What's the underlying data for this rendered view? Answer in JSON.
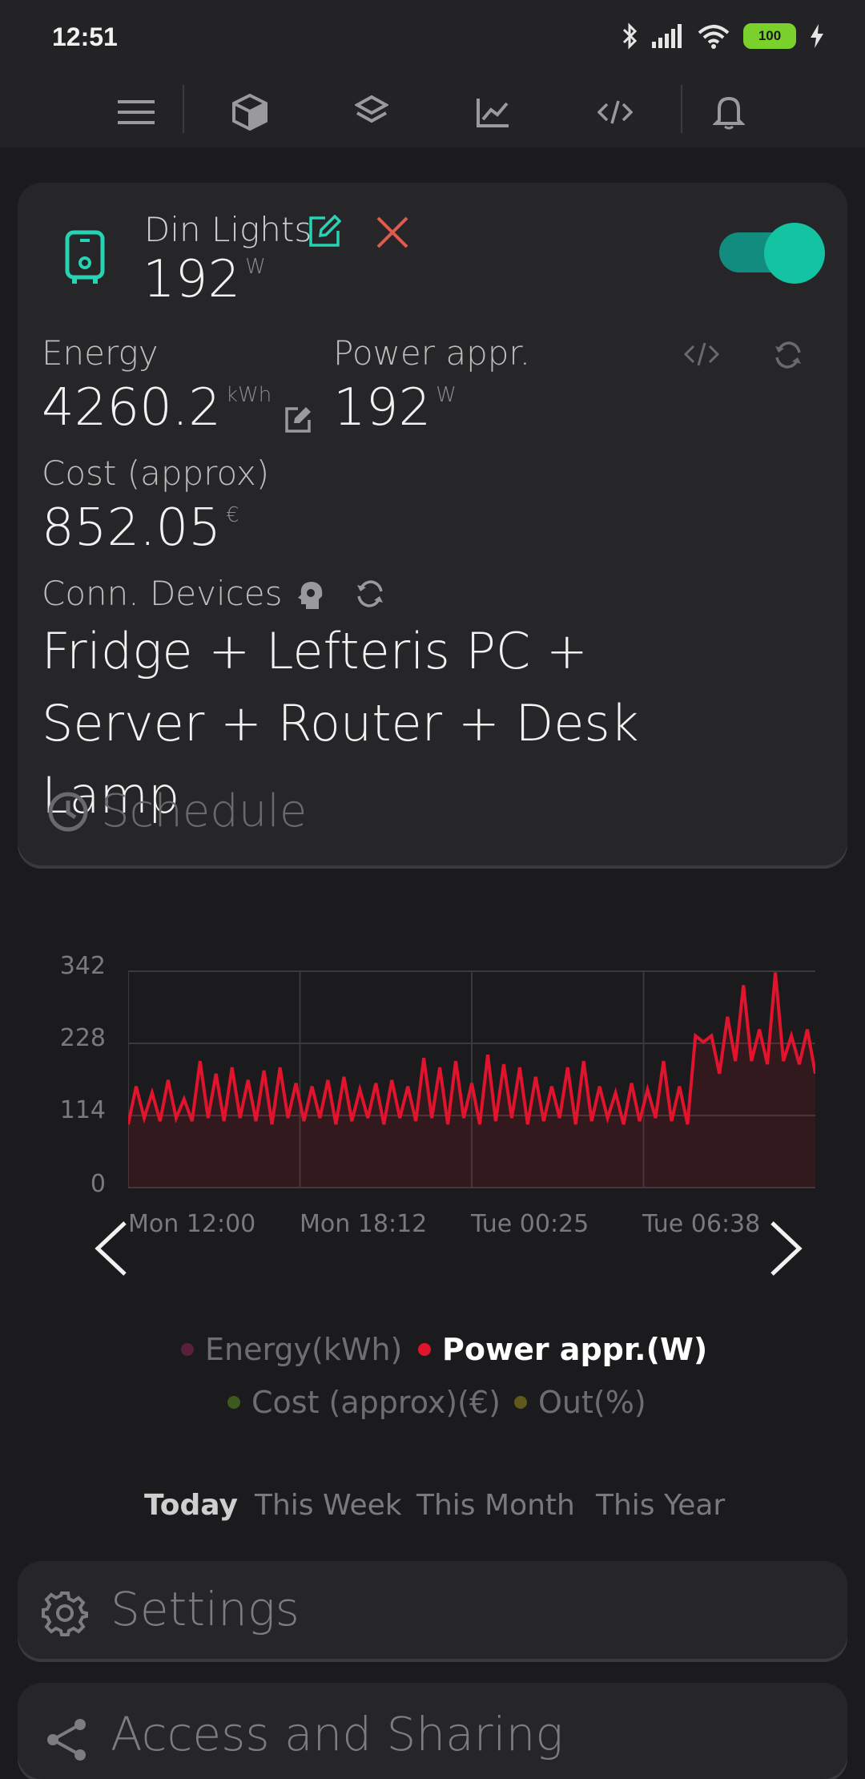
{
  "status_bar": {
    "time": "12:51",
    "battery": "100"
  },
  "nav": {
    "items": [
      "menu-icon",
      "cube-icon",
      "layers-icon",
      "chart-icon",
      "code-icon",
      "bell-icon"
    ]
  },
  "device": {
    "name": "Din Lights",
    "power_value": "192",
    "power_unit": "W",
    "toggle_on": true
  },
  "stats": {
    "energy_label": "Energy",
    "energy_value": "4260.2",
    "energy_unit": "kWh",
    "power_label": "Power appr.",
    "power_value": "192",
    "power_unit": "W",
    "cost_label": "Cost (approx)",
    "cost_value": "852.05",
    "cost_unit": "€",
    "devices_label": "Conn. Devices",
    "devices_value": "Fridge + Lefteris PC + Server + Router + Desk Lamp"
  },
  "schedule_label": "Schedule",
  "chart_data": {
    "type": "area",
    "title": "",
    "ylabel": "",
    "xlabel": "",
    "ylim": [
      0,
      342
    ],
    "yticks": [
      "342",
      "228",
      "114",
      "0"
    ],
    "xticks": [
      "Mon 12:00",
      "Mon 18:12",
      "Tue 00:25",
      "Tue 06:38"
    ],
    "color": "#e0142c",
    "series": [
      {
        "name": "Power appr.(W)",
        "values": [
          100,
          160,
          110,
          150,
          105,
          170,
          110,
          140,
          105,
          200,
          110,
          180,
          105,
          190,
          110,
          170,
          105,
          185,
          100,
          190,
          110,
          165,
          105,
          160,
          110,
          170,
          100,
          175,
          105,
          155,
          110,
          165,
          100,
          170,
          110,
          160,
          105,
          205,
          110,
          190,
          100,
          200,
          110,
          165,
          100,
          210,
          105,
          195,
          110,
          190,
          100,
          175,
          105,
          160,
          110,
          190,
          100,
          200,
          105,
          160,
          110,
          150,
          100,
          165,
          105,
          155,
          110,
          200,
          105,
          160,
          100,
          240,
          230,
          240,
          180,
          270,
          200,
          320,
          200,
          250,
          195,
          340,
          200,
          240,
          195,
          250,
          180
        ]
      }
    ]
  },
  "legend": [
    {
      "label": "Energy(kWh)",
      "color": "#5a1f3d",
      "active": false
    },
    {
      "label": "Power appr.(W)",
      "color": "#e0142c",
      "active": true
    },
    {
      "label": "Cost (approx)(€)",
      "color": "#3c5a1e",
      "active": false
    },
    {
      "label": "Out(%)",
      "color": "#5f5a1a",
      "active": false
    }
  ],
  "ranges": {
    "today": "Today",
    "week": "This Week",
    "month": "This Month",
    "year": "This Year"
  },
  "settings_label": "Settings",
  "access_label": "Access and Sharing"
}
